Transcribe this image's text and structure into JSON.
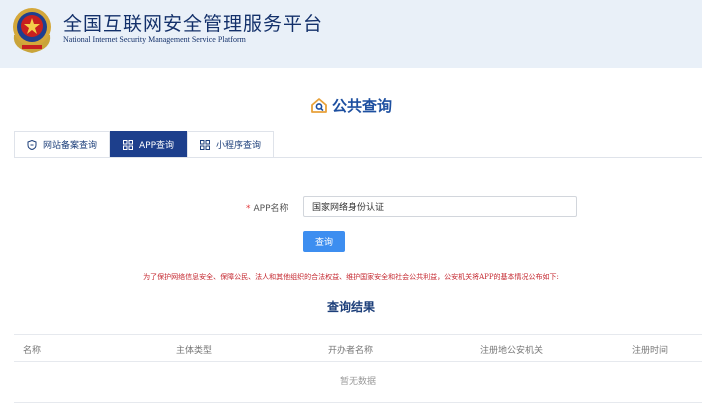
{
  "header": {
    "title": "全国互联网安全管理服务平台",
    "subtitle": "National Internet Security Management Service Platform"
  },
  "page": {
    "heading": "公共查询",
    "heading_icon": "house-search-icon"
  },
  "tabs": [
    {
      "label": "网站备案查询",
      "icon": "shield-icon",
      "active": false
    },
    {
      "label": "APP查询",
      "icon": "grid-icon",
      "active": true
    },
    {
      "label": "小程序查询",
      "icon": "grid-icon",
      "active": false
    }
  ],
  "form": {
    "required_mark": "*",
    "label": "APP名称",
    "value": "国家网络身份认证",
    "button": "查询"
  },
  "notice": "为了保护网络信息安全、保障公民、法人和其他组织的合法权益、维护国家安全和社会公共利益，公安机关将APP的基本情况公布如下:",
  "results": {
    "title": "查询结果",
    "columns": [
      "名称",
      "主体类型",
      "开办者名称",
      "注册地公安机关",
      "注册时间"
    ],
    "empty_text": "暂无数据"
  },
  "colors": {
    "brand": "#13306a",
    "active_tab": "#1d3f8c",
    "button": "#3d8ef0",
    "notice": "#c4262e"
  }
}
